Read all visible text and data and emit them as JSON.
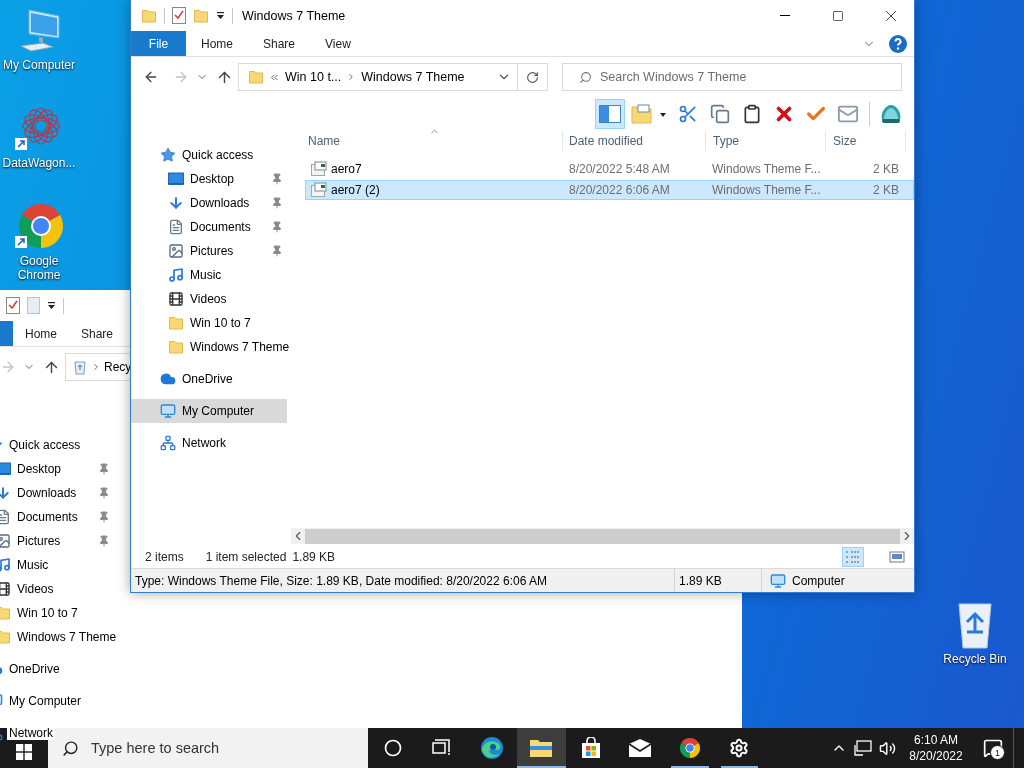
{
  "desktop_icons": [
    {
      "label": "My Computer",
      "kind": "computer",
      "shortcut": false
    },
    {
      "label": "DataWagon...",
      "kind": "datawagon",
      "shortcut": true
    },
    {
      "label": "Google Chrome",
      "kind": "chrome",
      "shortcut": true
    }
  ],
  "recycle_bin": {
    "label": "Recycle Bin"
  },
  "back_window": {
    "quick_toolbar": [
      {
        "kind": "properties"
      },
      {
        "kind": "blank"
      }
    ],
    "file_tab": true,
    "ribbon_tabs": [
      {
        "label": "Home",
        "kind": "tab"
      },
      {
        "label": "Share",
        "kind": "tab"
      }
    ],
    "address": {
      "kind": "recycle",
      "collapsed": false,
      "crumbs": [
        "Recy"
      ]
    },
    "nav": [
      {
        "label": "Quick access",
        "kind": "star",
        "selected": false,
        "children": [
          {
            "label": "Desktop",
            "kind": "desktop",
            "pinned": true,
            "selected": false
          },
          {
            "label": "Downloads",
            "kind": "download",
            "pinned": true,
            "selected": false
          },
          {
            "label": "Documents",
            "kind": "document",
            "pinned": true,
            "selected": false
          },
          {
            "label": "Pictures",
            "kind": "picture",
            "pinned": true,
            "selected": false
          },
          {
            "label": "Music",
            "kind": "music",
            "pinned": false,
            "selected": false
          },
          {
            "label": "Videos",
            "kind": "video",
            "pinned": false,
            "selected": false
          },
          {
            "label": "Win 10 to 7",
            "kind": "folder",
            "pinned": false,
            "selected": false
          },
          {
            "label": "Windows 7 Theme",
            "kind": "folder",
            "pinned": false,
            "selected": false
          }
        ]
      },
      {
        "label": "OneDrive",
        "kind": "cloud",
        "selected": false
      },
      {
        "label": "My Computer",
        "kind": "computer",
        "selected": false
      },
      {
        "label": "Network",
        "kind": "network",
        "selected": false
      }
    ]
  },
  "window": {
    "title": "Windows 7 Theme",
    "quick_toolbar": [
      {
        "kind": "folder"
      },
      {
        "kind": "properties"
      },
      {
        "kind": "folder"
      }
    ],
    "ribbon_tabs": [
      {
        "label": "File",
        "kind": "file"
      },
      {
        "label": "Home",
        "kind": "tab"
      },
      {
        "label": "Share",
        "kind": "tab"
      },
      {
        "label": "View",
        "kind": "tab"
      }
    ],
    "address": {
      "kind": "folder",
      "collapsed": true,
      "crumbs": [
        "Win 10 t...",
        "Windows 7 Theme"
      ]
    },
    "search": {
      "placeholder": "Search Windows 7 Theme"
    },
    "toolbar": [
      {
        "kind": "preview-pane",
        "selected": true
      },
      {
        "kind": "new-folder",
        "selected": false
      },
      {
        "kind": "cut",
        "selected": false
      },
      {
        "kind": "copy",
        "selected": false
      },
      {
        "kind": "paste",
        "selected": false
      },
      {
        "kind": "delete",
        "selected": false
      },
      {
        "kind": "check",
        "selected": false
      },
      {
        "kind": "rename",
        "selected": false
      },
      {
        "kind": "shell",
        "selected": false
      }
    ],
    "nav": [
      {
        "label": "Quick access",
        "kind": "star",
        "selected": false,
        "children": [
          {
            "label": "Desktop",
            "kind": "desktop",
            "pinned": true,
            "selected": false
          },
          {
            "label": "Downloads",
            "kind": "download",
            "pinned": true,
            "selected": false
          },
          {
            "label": "Documents",
            "kind": "document",
            "pinned": true,
            "selected": false
          },
          {
            "label": "Pictures",
            "kind": "picture",
            "pinned": true,
            "selected": false
          },
          {
            "label": "Music",
            "kind": "music",
            "pinned": false,
            "selected": false
          },
          {
            "label": "Videos",
            "kind": "video",
            "pinned": false,
            "selected": false
          },
          {
            "label": "Win 10 to 7",
            "kind": "folder",
            "pinned": false,
            "selected": false
          },
          {
            "label": "Windows 7 Theme",
            "kind": "folder",
            "pinned": false,
            "selected": false
          }
        ]
      },
      {
        "label": "OneDrive",
        "kind": "cloud",
        "selected": false
      },
      {
        "label": "My Computer",
        "kind": "computer",
        "selected": true
      },
      {
        "label": "Network",
        "kind": "network",
        "selected": false
      }
    ],
    "columns": [
      "Name",
      "Date modified",
      "Type",
      "Size"
    ],
    "rows": [
      {
        "name": "aero7",
        "date": "8/20/2022 5:48 AM",
        "type": "Windows Theme F...",
        "size": "2 KB",
        "selected": false
      },
      {
        "name": "aero7 (2)",
        "date": "8/20/2022 6:06 AM",
        "type": "Windows Theme F...",
        "size": "2 KB",
        "selected": true
      }
    ],
    "status": {
      "count": "2 items",
      "selection": "1 item selected",
      "size": "1.89 KB"
    },
    "views": [
      {
        "kind": "details",
        "selected": true
      },
      {
        "kind": "large-icons",
        "selected": false
      }
    ],
    "details": {
      "info": "Type: Windows Theme File, Size: 1.89 KB, Date modified: 8/20/2022 6:06 AM",
      "size": "1.89 KB",
      "location": "Computer"
    }
  },
  "taskbar": {
    "search": {
      "placeholder": "Type here to search"
    },
    "apps": [
      {
        "kind": "cortana",
        "active": false,
        "running": false
      },
      {
        "kind": "task-view",
        "active": false,
        "running": false
      },
      {
        "kind": "edge",
        "active": false,
        "running": false
      },
      {
        "kind": "explorer",
        "active": true,
        "running": true
      },
      {
        "kind": "store",
        "active": false,
        "running": false
      },
      {
        "kind": "mail",
        "active": false,
        "running": false
      },
      {
        "kind": "chrome",
        "active": false,
        "running": true
      },
      {
        "kind": "settings",
        "active": false,
        "running": true
      }
    ],
    "tray": [
      {
        "kind": "chevron"
      },
      {
        "kind": "network"
      },
      {
        "kind": "volume"
      }
    ],
    "clock": {
      "time": "6:10 AM",
      "date": "8/20/2022"
    },
    "notifications": {
      "count": "1"
    }
  }
}
